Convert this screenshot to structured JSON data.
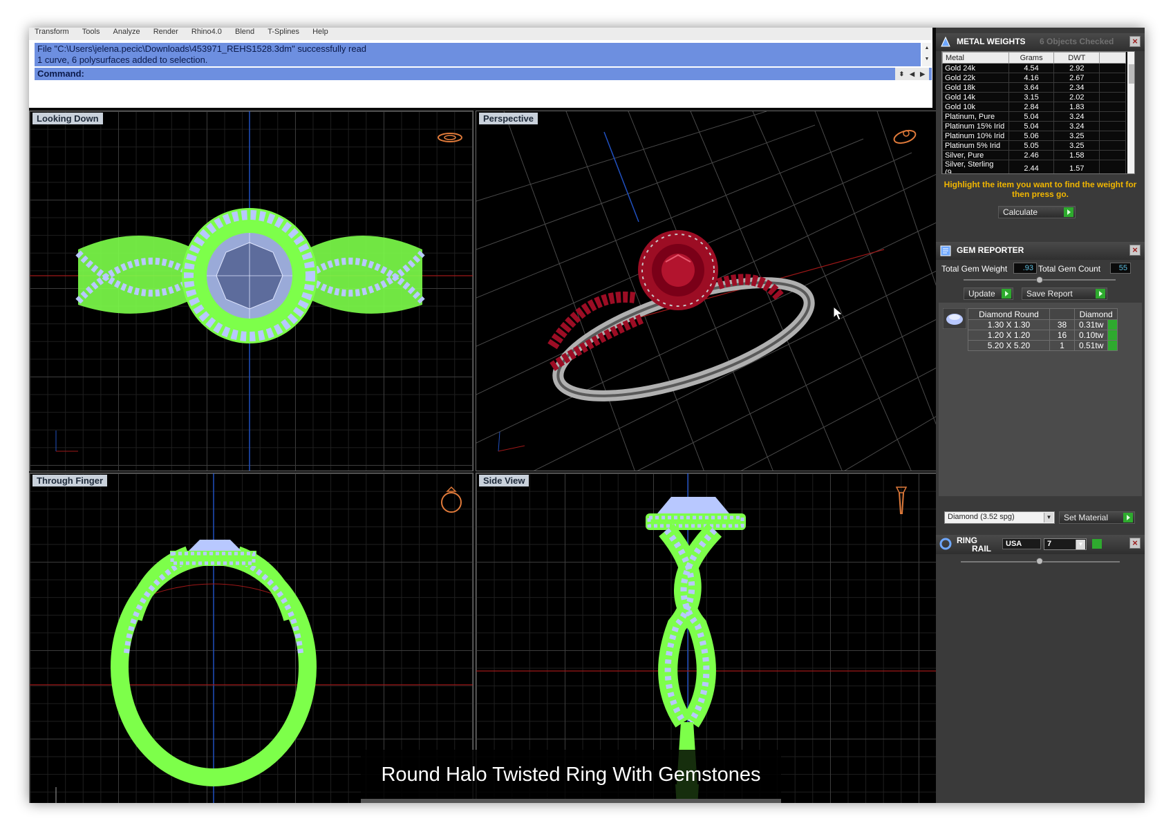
{
  "menu": [
    "Transform",
    "Tools",
    "Analyze",
    "Render",
    "Rhino4.0",
    "Blend",
    "T-Splines",
    "Help"
  ],
  "command": {
    "history": [
      "File \"C:\\Users\\jelena.pecic\\Downloads\\453971_REHS1528.3dm\" successfully read",
      "1 curve, 6 polysurfaces added to selection."
    ],
    "prompt": "Command:"
  },
  "viewports": {
    "top": "Looking Down",
    "perspective": "Perspective",
    "front": "Through Finger",
    "side": "Side View"
  },
  "caption": "Round Halo Twisted Ring With Gemstones",
  "metal_weights": {
    "title": "METAL WEIGHTS",
    "status": "6 Objects Checked",
    "columns": [
      "Metal",
      "Grams",
      "DWT"
    ],
    "rows": [
      [
        "Gold 24k",
        "4.54",
        "2.92"
      ],
      [
        "Gold 22k",
        "4.16",
        "2.67"
      ],
      [
        "Gold 18k",
        "3.64",
        "2.34"
      ],
      [
        "Gold 14k",
        "3.15",
        "2.02"
      ],
      [
        "Gold 10k",
        "2.84",
        "1.83"
      ],
      [
        "Platinum, Pure",
        "5.04",
        "3.24"
      ],
      [
        "Platinum 15% Irid",
        "5.04",
        "3.24"
      ],
      [
        "Platinum 10% Irid",
        "5.06",
        "3.25"
      ],
      [
        "Platinum 5% Irid",
        "5.05",
        "3.25"
      ],
      [
        "Silver, Pure",
        "2.46",
        "1.58"
      ],
      [
        "Silver, Sterling (9...",
        "2.44",
        "1.57"
      ]
    ],
    "hint": "Highlight the item you want to find the weight for then press go.",
    "calculate": "Calculate"
  },
  "gem_reporter": {
    "title": "GEM REPORTER",
    "total_weight_label": "Total Gem Weight",
    "total_weight": ".93",
    "total_count_label": "Total Gem Count",
    "total_count": "55",
    "update": "Update",
    "save_report": "Save Report",
    "columns": [
      "Diamond Round",
      "",
      "Diamond"
    ],
    "rows": [
      [
        "1.30 X 1.30",
        "38",
        "0.31tw"
      ],
      [
        "1.20 X 1.20",
        "16",
        "0.10tw"
      ],
      [
        "5.20 X 5.20",
        "1",
        "0.51tw"
      ]
    ],
    "material": "Diamond    (3.52 spg)",
    "set_material": "Set Material"
  },
  "ring_rail": {
    "title_line1": "RING",
    "title_line2": "RAIL",
    "region": "USA",
    "size": "7"
  },
  "colors": {
    "wire_green": "#7dff4a",
    "gem_blue": "#b8c8ff",
    "ruby": "#9c0d24",
    "accent_orange": "#f2b700",
    "history_blue": "#6d8fe0"
  }
}
